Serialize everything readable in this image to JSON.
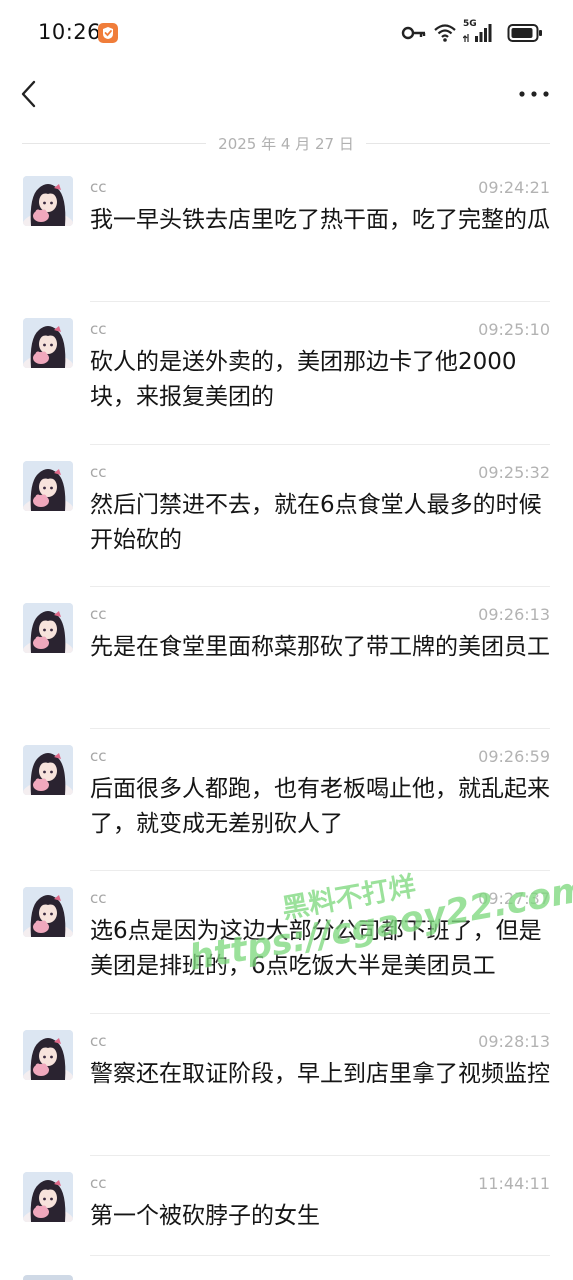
{
  "status_bar": {
    "time": "10:26",
    "network_label": "5G",
    "icons": [
      "app-badge-icon",
      "key-icon",
      "wifi-icon",
      "signal-icon",
      "battery-icon"
    ]
  },
  "nav": {
    "back_icon": "chevron-left-icon",
    "more_icon": "more-horizontal-icon"
  },
  "date_divider": "2025 年 4 月 27 日",
  "messages": [
    {
      "name": "cc",
      "time": "09:24:21",
      "text": "我一早头铁去店里吃了热干面，吃了完整的瓜"
    },
    {
      "name": "cc",
      "time": "09:25:10",
      "text": "砍人的是送外卖的，美团那边卡了他2000块，来报复美团的"
    },
    {
      "name": "cc",
      "time": "09:25:32",
      "text": "然后门禁进不去，就在6点食堂人最多的时候开始砍的"
    },
    {
      "name": "cc",
      "time": "09:26:13",
      "text": "先是在食堂里面称菜那砍了带工牌的美团员工"
    },
    {
      "name": "cc",
      "time": "09:26:59",
      "text": "后面很多人都跑，也有老板喝止他，就乱起来了，就变成无差别砍人了"
    },
    {
      "name": "cc",
      "time": "09:27:37",
      "text": "选6点是因为这边大部分公司都下班了，但是美团是排班的，6点吃饭大半是美团员工"
    },
    {
      "name": "cc",
      "time": "09:28:13",
      "text": "警察还在取证阶段，早上到店里拿了视频监控"
    },
    {
      "name": "cc",
      "time": "11:44:11",
      "text": "第一个被砍脖子的女生"
    }
  ],
  "watermark": {
    "line1": "黑料不打烊",
    "line2": "https://cgaoy22.com"
  },
  "colors": {
    "accent_badge": "#f07d3a",
    "watermark": "#7fd97f",
    "divider_text": "#b0b0b0"
  }
}
